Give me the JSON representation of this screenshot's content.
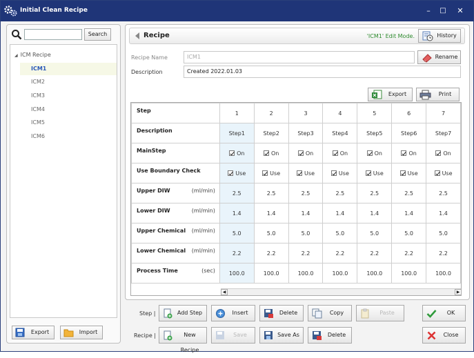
{
  "window": {
    "title": "Initial Clean Recipe",
    "minimize": "–",
    "maximize": "□",
    "close": "✕"
  },
  "left": {
    "search_button": "Search",
    "search_value": "",
    "tree_root": "ICM Recipe",
    "items": [
      "ICM1",
      "ICM2",
      "ICM3",
      "ICM4",
      "ICM5",
      "ICM6"
    ],
    "selected": "ICM1",
    "export_label": "Export",
    "import_label": "Import"
  },
  "recipe": {
    "title": "Recipe",
    "mode_text": "'ICM1' Edit Mode.",
    "history_label": "History",
    "name_label": "Recipe Name",
    "name_value": "ICM1",
    "rename_label": "Rename",
    "description_label": "Description",
    "description_value": "Created 2022.01.03",
    "export_label": "Export",
    "print_label": "Print"
  },
  "grid": {
    "rows": [
      {
        "label": "Step",
        "unit": ""
      },
      {
        "label": "Description",
        "unit": ""
      },
      {
        "label": "MainStep",
        "unit": ""
      },
      {
        "label": "Use Boundary Check",
        "unit": ""
      },
      {
        "label": "Upper DIW",
        "unit": "(ml/min)"
      },
      {
        "label": "Lower DIW",
        "unit": "(ml/min)"
      },
      {
        "label": "Upper Chemical",
        "unit": "(ml/min)"
      },
      {
        "label": "Lower Chemical",
        "unit": "(ml/min)"
      },
      {
        "label": "Process Time",
        "unit": "(sec)"
      }
    ],
    "columns": [
      {
        "step": "1",
        "desc": "Step1",
        "main": "On",
        "boundary": "Use",
        "udiw": "2.5",
        "ldiw": "1.4",
        "uchem": "5.0",
        "lchem": "2.2",
        "time": "100.0"
      },
      {
        "step": "2",
        "desc": "Step2",
        "main": "On",
        "boundary": "Use",
        "udiw": "2.5",
        "ldiw": "1.4",
        "uchem": "5.0",
        "lchem": "2.2",
        "time": "100.0"
      },
      {
        "step": "3",
        "desc": "Step3",
        "main": "On",
        "boundary": "Use",
        "udiw": "2.5",
        "ldiw": "1.4",
        "uchem": "5.0",
        "lchem": "2.2",
        "time": "100.0"
      },
      {
        "step": "4",
        "desc": "Step4",
        "main": "On",
        "boundary": "Use",
        "udiw": "2.5",
        "ldiw": "1.4",
        "uchem": "5.0",
        "lchem": "2.2",
        "time": "100.0"
      },
      {
        "step": "5",
        "desc": "Step5",
        "main": "On",
        "boundary": "Use",
        "udiw": "2.5",
        "ldiw": "1.4",
        "uchem": "5.0",
        "lchem": "2.2",
        "time": "100.0"
      },
      {
        "step": "6",
        "desc": "Step6",
        "main": "On",
        "boundary": "Use",
        "udiw": "2.5",
        "ldiw": "1.4",
        "uchem": "5.0",
        "lchem": "2.2",
        "time": "100.0"
      },
      {
        "step": "7",
        "desc": "Step7",
        "main": "On",
        "boundary": "Use",
        "udiw": "2.5",
        "ldiw": "1.4",
        "uchem": "5.0",
        "lchem": "2.2",
        "time": "100.0"
      }
    ]
  },
  "bottom": {
    "step_label": "Step |",
    "recipe_label": "Recipe |",
    "add_step": "Add Step",
    "insert": "Insert",
    "delete": "Delete",
    "copy": "Copy",
    "paste": "Paste",
    "new_recipe": "New Recipe",
    "save": "Save",
    "save_as": "Save As",
    "delete_recipe": "Delete",
    "ok": "OK",
    "close": "Close"
  }
}
